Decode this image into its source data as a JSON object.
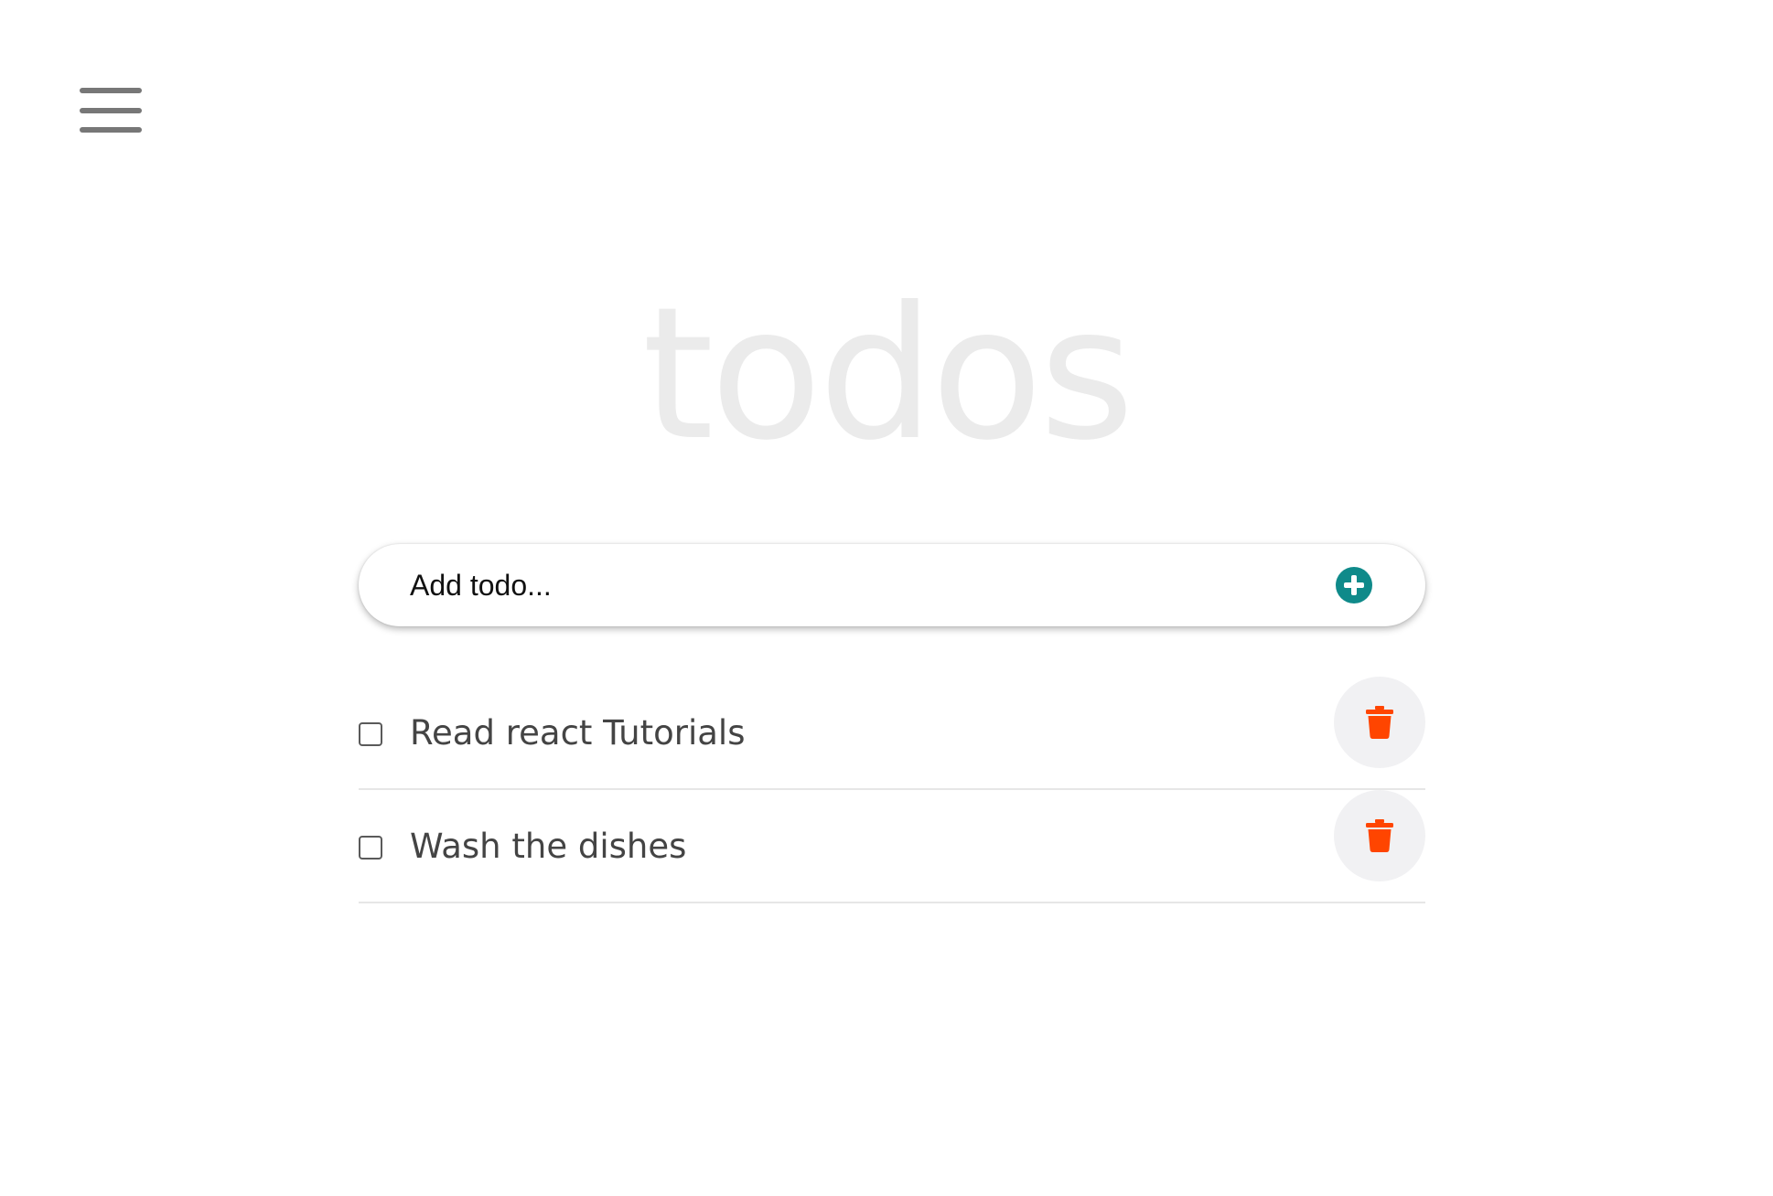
{
  "app": {
    "title": "todos"
  },
  "menu": {
    "icon": "hamburger-menu-icon"
  },
  "add_form": {
    "placeholder": "Add todo...",
    "value": "",
    "button_icon": "plus-circle-icon",
    "button_color": "#0f8a8a"
  },
  "todos": [
    {
      "text": "Read react Tutorials",
      "completed": false,
      "delete_icon": "trash-icon"
    },
    {
      "text": "Wash the dishes",
      "completed": false,
      "delete_icon": "trash-icon"
    }
  ],
  "colors": {
    "title": "#ebebeb",
    "delete_icon": "#ff4500",
    "delete_button_bg": "#f1f1f3",
    "menu_icon": "#777777",
    "todo_text": "#444444"
  }
}
